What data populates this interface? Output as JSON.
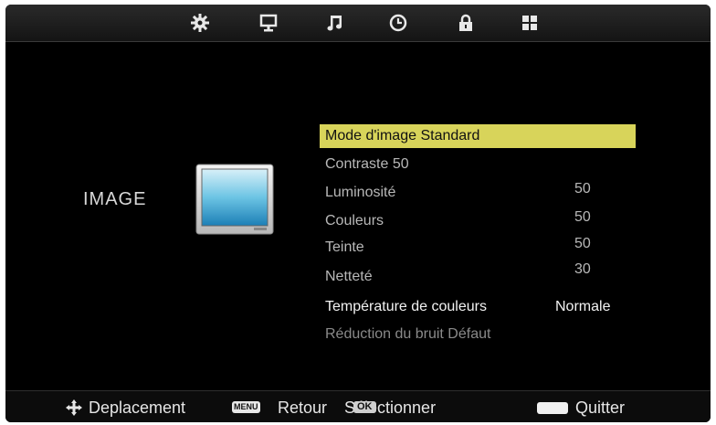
{
  "tabs": [
    {
      "name": "picture-settings",
      "icon": "gear-icon",
      "active": true
    },
    {
      "name": "display",
      "icon": "monitor-icon"
    },
    {
      "name": "sound",
      "icon": "music-note-icon"
    },
    {
      "name": "time",
      "icon": "clock-icon"
    },
    {
      "name": "lock",
      "icon": "lock-icon"
    },
    {
      "name": "setup",
      "icon": "grid-icon"
    }
  ],
  "section_title": "IMAGE",
  "menu": {
    "items": [
      {
        "label": "Mode d'image Standard",
        "value": "",
        "state": "selected"
      },
      {
        "label": "Contraste 50",
        "value": "",
        "state": "normal"
      },
      {
        "label": "Luminosité",
        "value": "50",
        "state": "normal"
      },
      {
        "label": "Couleurs",
        "value": "50",
        "state": "normal"
      },
      {
        "label": "Teinte",
        "value": "50",
        "state": "normal"
      },
      {
        "label": "Netteté",
        "value": "30",
        "state": "normal"
      },
      {
        "label": "Température de couleurs",
        "value": "Normale",
        "state": "white"
      },
      {
        "label": "Réduction du bruit Défaut",
        "value": "",
        "state": "dim"
      }
    ]
  },
  "footer": {
    "move_label": "Deplacement",
    "menu_key": "MENU",
    "back_label": "Retour",
    "select_label": "Sélectionner",
    "ok_key": "OK",
    "quit_label": "Quitter"
  },
  "colors": {
    "highlight": "#d8d45a",
    "background": "#000000",
    "text": "#b8b8b8"
  }
}
